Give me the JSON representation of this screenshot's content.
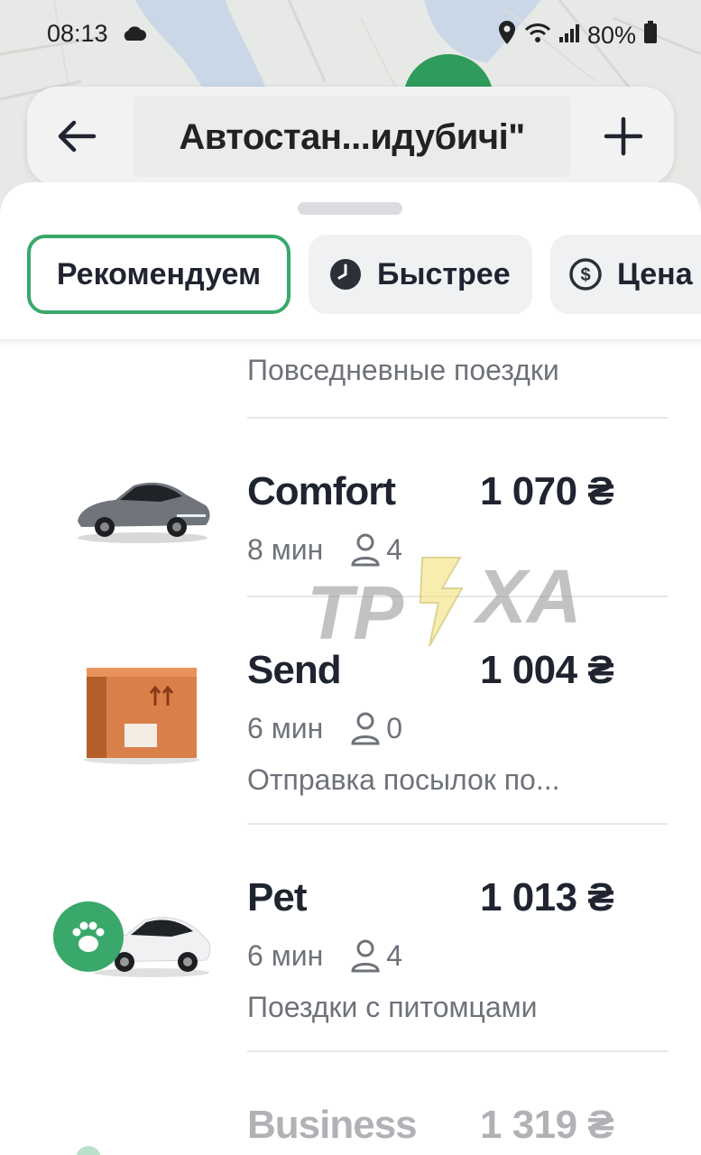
{
  "status_bar": {
    "time": "08:13",
    "battery": "80%"
  },
  "header": {
    "route_title": "Автостан...идубичі\""
  },
  "filters": [
    {
      "label": "Рекомендуем",
      "active": true
    },
    {
      "label": "Быстрее",
      "icon": "clock-icon"
    },
    {
      "label": "Цена",
      "icon": "dollar-coin-icon"
    }
  ],
  "partial_row": {
    "description": "Повседневные поездки"
  },
  "rides": [
    {
      "name": "Comfort",
      "price": "1 070 ₴",
      "eta": "8 мин",
      "seats": "4",
      "description": "",
      "image": "car-gray-icon"
    },
    {
      "name": "Send",
      "price": "1 004 ₴",
      "eta": "6 мин",
      "seats": "0",
      "description": "Отправка посылок по...",
      "image": "parcel-box-icon"
    },
    {
      "name": "Pet",
      "price": "1 013 ₴",
      "eta": "6 мин",
      "seats": "4",
      "description": "Поездки с питомцами",
      "image": "car-white-paw-icon"
    },
    {
      "name": "Business",
      "price": "1 319 ₴",
      "image": "car-business-icon"
    }
  ],
  "watermark": {
    "text_left": "ТР",
    "text_right": "ХА"
  },
  "colors": {
    "accent_green": "#3aa86b",
    "text_primary": "#1f2430",
    "text_secondary": "#6e727a"
  }
}
